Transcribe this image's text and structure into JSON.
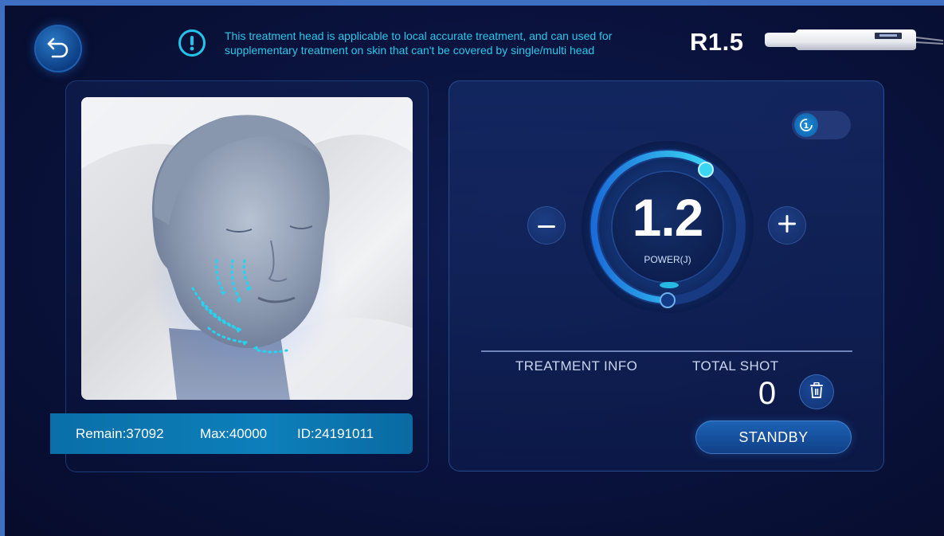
{
  "header": {
    "back_icon": "undo-arrow-icon",
    "notice_icon": "exclamation-circle-icon",
    "notice_text": "This treatment head is applicable to local accurate treatment, and can used for supplementary treatment on skin that can't be covered by single/multi head",
    "head_label": "R1.5"
  },
  "face_panel": {
    "remain": "Remain:37092",
    "max": "Max:40000",
    "id": "ID:24191011"
  },
  "power": {
    "value": "1.2",
    "label": "POWER(J)",
    "minus_icon": "minus-icon",
    "plus_icon": "plus-icon"
  },
  "mode_toggle": {
    "icon": "cycle-one-icon",
    "text": "1"
  },
  "treatment": {
    "info_label": "TREATMENT INFO",
    "total_shot_label": "TOTAL SHOT",
    "total_shot_value": "0",
    "trash_icon": "trash-icon",
    "standby_label": "STANDBY"
  },
  "colors": {
    "accent": "#28c8ec",
    "bar": "#0d7fba",
    "background": "#0a1440"
  }
}
